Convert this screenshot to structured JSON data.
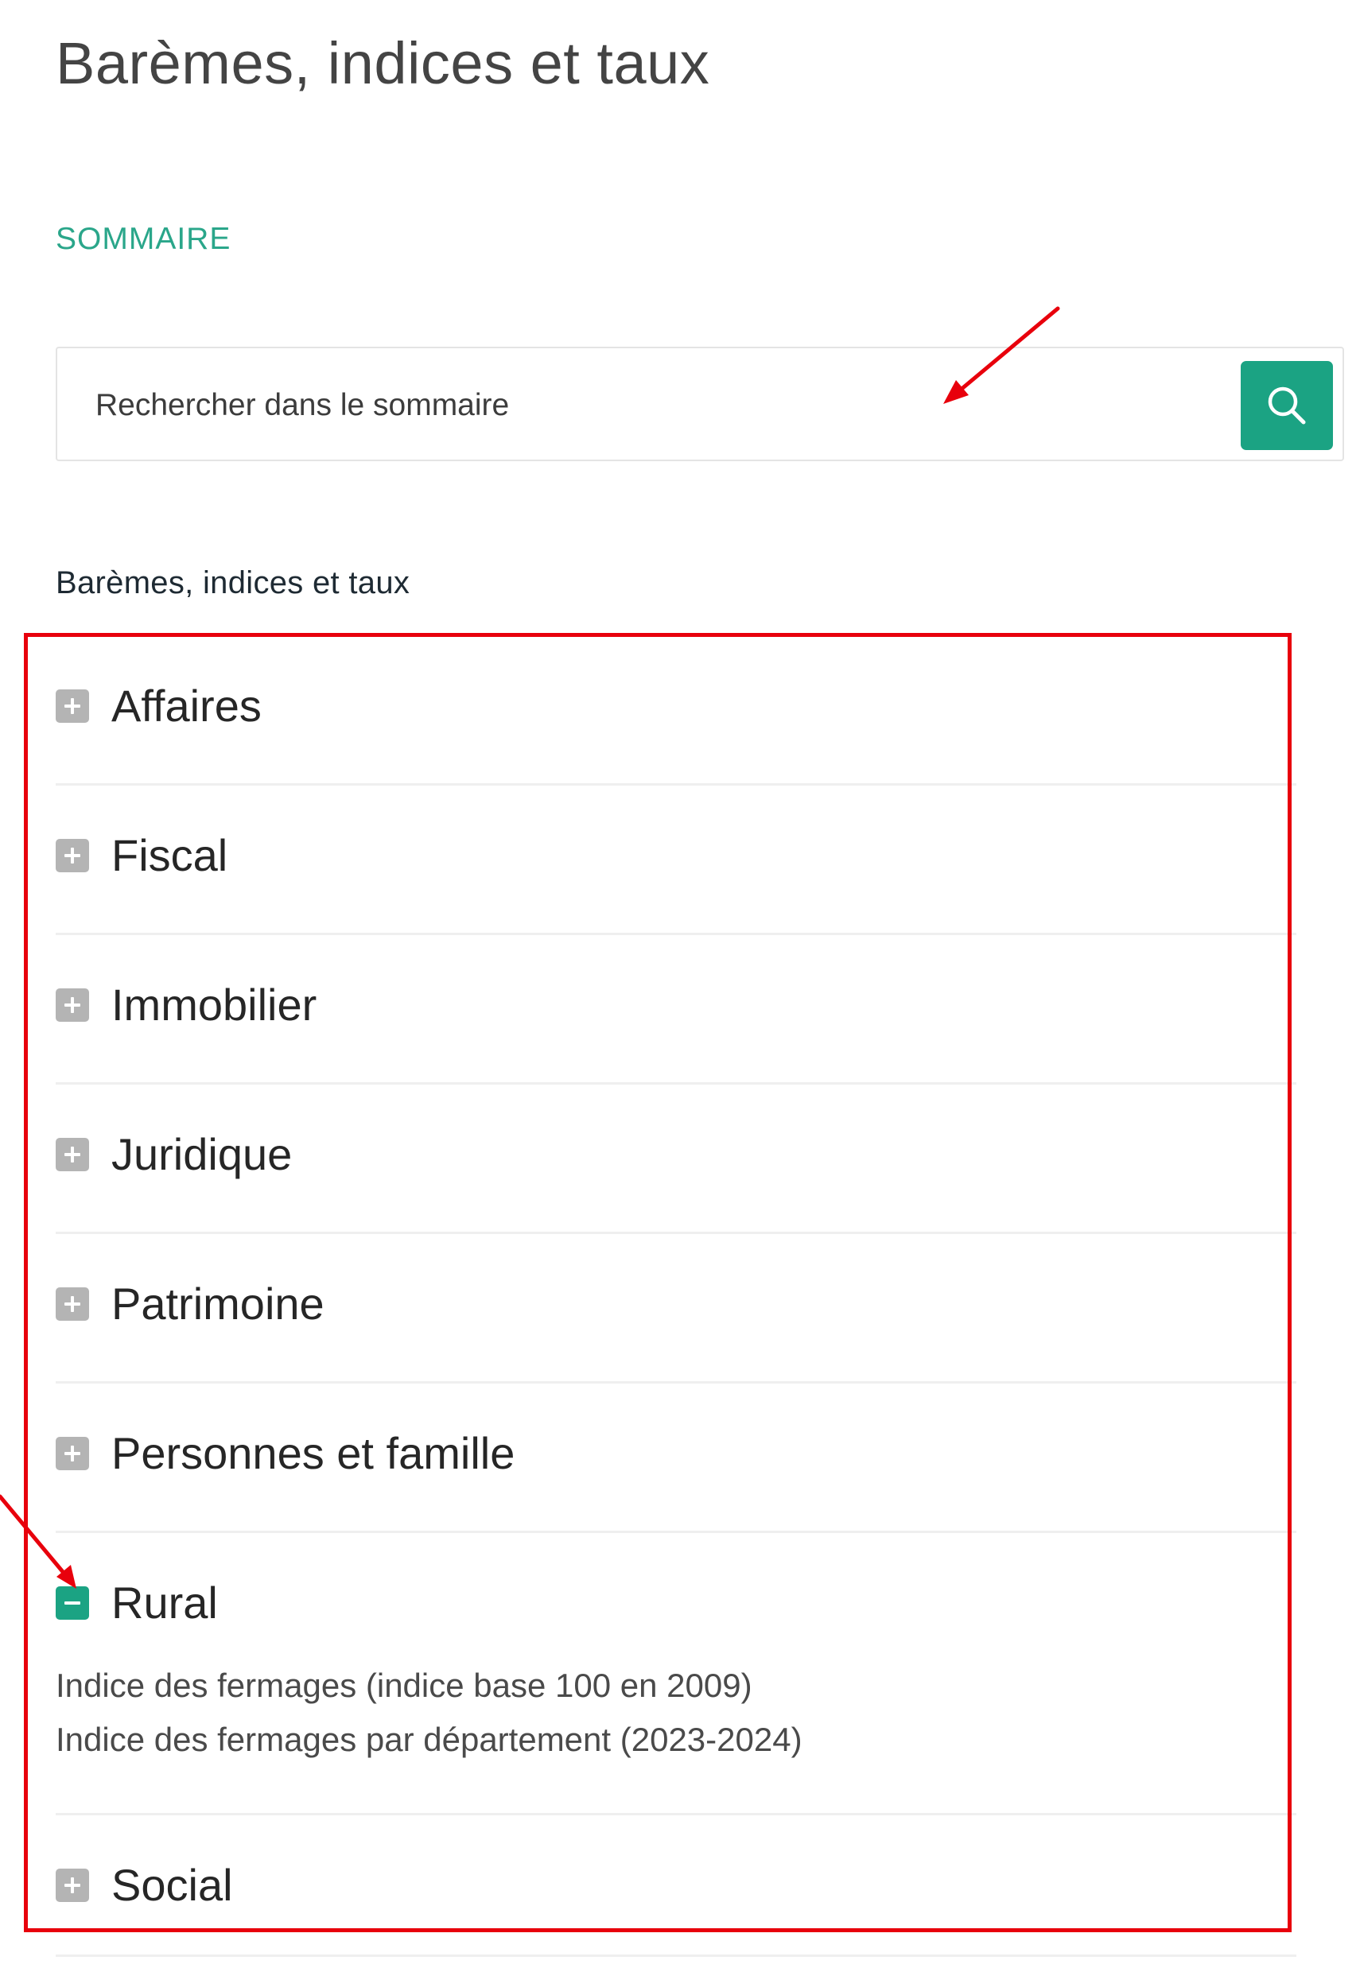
{
  "page": {
    "title": "Barèmes, indices et taux"
  },
  "summary": {
    "label": "SOMMAIRE",
    "search_placeholder": "Rechercher dans le sommaire",
    "search_icon": "search-icon"
  },
  "toc": {
    "heading": "Barèmes, indices et taux",
    "items": [
      {
        "label": "Affaires",
        "expanded": false
      },
      {
        "label": "Fiscal",
        "expanded": false
      },
      {
        "label": "Immobilier",
        "expanded": false
      },
      {
        "label": "Juridique",
        "expanded": false
      },
      {
        "label": "Patrimoine",
        "expanded": false
      },
      {
        "label": "Personnes et famille",
        "expanded": false
      },
      {
        "label": "Rural",
        "expanded": true,
        "children": [
          "Indice des fermages (indice base 100 en 2009)",
          "Indice des fermages par département (2023-2024)"
        ]
      },
      {
        "label": "Social",
        "expanded": false
      }
    ]
  },
  "colors": {
    "accent": "#1ba383",
    "summary_label": "#2aa68a",
    "toggle_collapsed": "#b4b4b4",
    "annotation": "#e8000c",
    "divider": "#efefef"
  }
}
